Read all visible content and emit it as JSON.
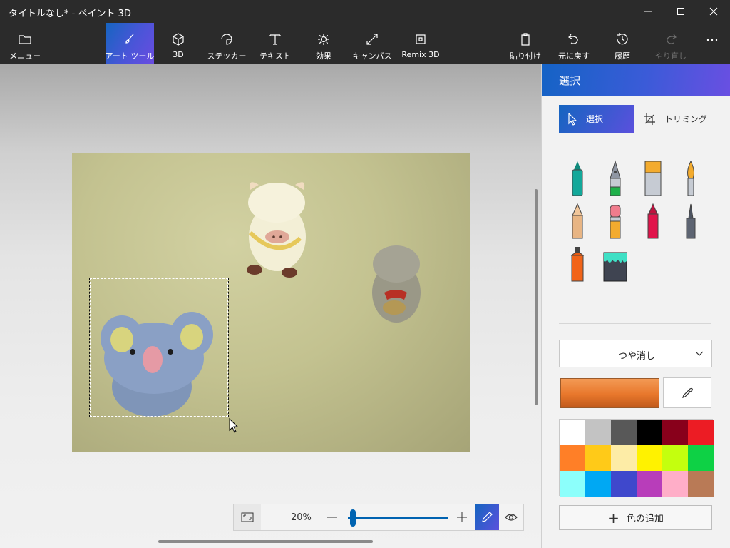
{
  "window": {
    "title": "タイトルなし* - ペイント 3D"
  },
  "toolbar": {
    "items": [
      {
        "label": "メニュー",
        "icon": "folder-icon"
      },
      {
        "label": "アート ツール",
        "icon": "brush-icon",
        "active": true
      },
      {
        "label": "3D",
        "icon": "cube-icon"
      },
      {
        "label": "ステッカー",
        "icon": "sticker-icon"
      },
      {
        "label": "テキスト",
        "icon": "text-icon"
      },
      {
        "label": "効果",
        "icon": "sun-icon"
      },
      {
        "label": "キャンバス",
        "icon": "canvas-resize-icon"
      },
      {
        "label": "Remix 3D",
        "icon": "remix-icon"
      },
      {
        "label": "貼り付け",
        "icon": "paste-icon"
      },
      {
        "label": "元に戻す",
        "icon": "undo-icon"
      },
      {
        "label": "履歴",
        "icon": "history-icon"
      },
      {
        "label": "やり直し",
        "icon": "redo-icon",
        "disabled": true
      },
      {
        "label": "",
        "icon": "more-icon"
      }
    ]
  },
  "zoom": {
    "percent": "20%",
    "slider_level": 0.05
  },
  "panel": {
    "title": "選択",
    "select_label": "選択",
    "trim_label": "トリミング",
    "brushes": [
      "marker-icon",
      "calligraphy-pen-icon",
      "oil-brush-icon",
      "watercolor-icon",
      "pencil-icon",
      "eraser-icon",
      "crayon-icon",
      "pixel-pen-icon",
      "spray-can-icon",
      "fill-bucket-icon"
    ],
    "finish": "つや消し",
    "current_color": "#e8772b",
    "palette": [
      "#ffffff",
      "#c3c3c3",
      "#585858",
      "#000000",
      "#88001b",
      "#ec1c24",
      "#ff7f27",
      "#ffca18",
      "#fdeca6",
      "#fff200",
      "#c4ff0e",
      "#0ed145",
      "#8cfffb",
      "#00a8f3",
      "#3f48cc",
      "#b83dba",
      "#ffaec8",
      "#b97a56"
    ],
    "add_color_label": "色の追加"
  }
}
